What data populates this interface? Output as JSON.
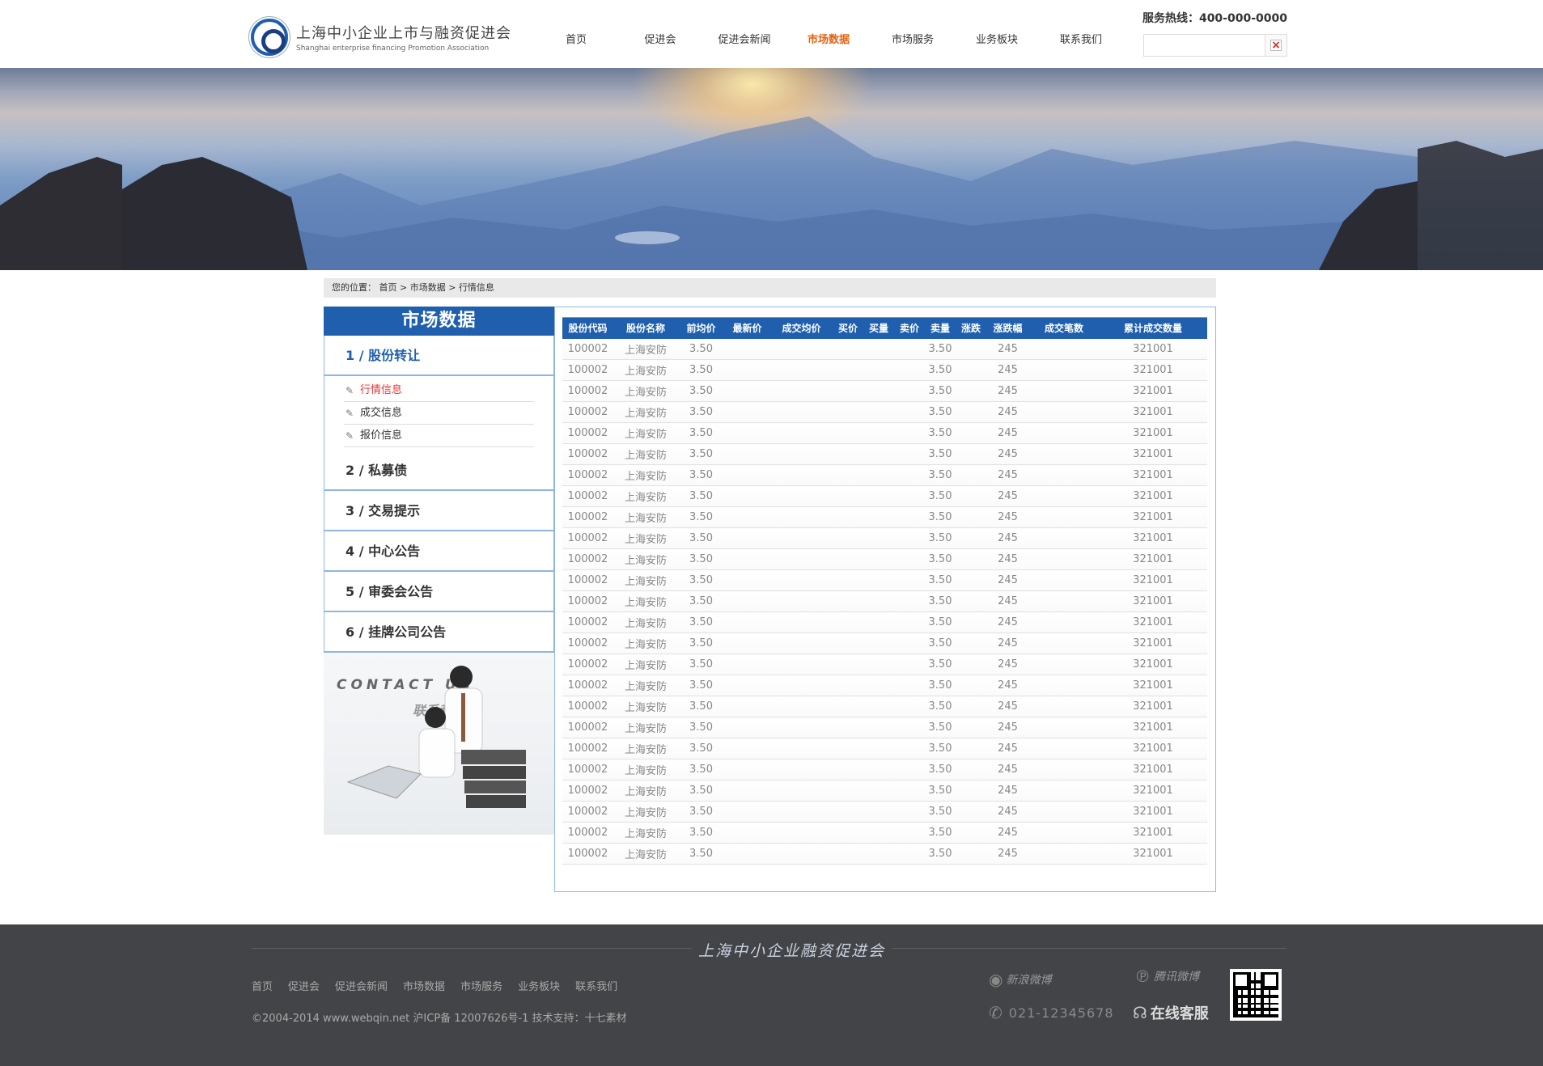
{
  "header": {
    "logo_cn": "上海中小企业上市与融资促进会",
    "logo_en": "Shanghai enterprise financing Promotion Association",
    "hotline": "服务热线：400-000-0000",
    "nav": [
      "首页",
      "促进会",
      "促进会新闻",
      "市场数据",
      "市场服务",
      "业务板块",
      "联系我们"
    ],
    "active_nav": "市场数据",
    "search_placeholder": ""
  },
  "breadcrumb": {
    "prefix": "您的位置：",
    "items": [
      "首页",
      "市场数据",
      "行情信息"
    ],
    "separator": ">"
  },
  "sidebar": {
    "title": "市场数据",
    "sections": [
      {
        "label": "1 / 股份转让",
        "sub": [
          "行情信息",
          "成交信息",
          "报价信息"
        ],
        "active_sub": "行情信息"
      },
      {
        "label": "2 / 私募债"
      },
      {
        "label": "3 / 交易提示"
      },
      {
        "label": "4 / 中心公告"
      },
      {
        "label": "5 / 审委会公告"
      },
      {
        "label": "6 / 挂牌公司公告"
      }
    ],
    "contact_en": "CONTACT US",
    "contact_cn": "联系我们"
  },
  "table": {
    "headers": [
      "股份代码",
      "股份名称",
      "前均价",
      "最新价",
      "成交均价",
      "买价",
      "买量",
      "卖价",
      "卖量",
      "涨跌",
      "涨跌幅",
      "成交笔数",
      "累计成交数量"
    ],
    "rows": [
      [
        "100002",
        "上海安防",
        "3.50",
        "",
        "",
        "",
        "",
        "",
        "3.50",
        "",
        "245",
        "",
        "321001"
      ],
      [
        "100002",
        "上海安防",
        "3.50",
        "",
        "",
        "",
        "",
        "",
        "3.50",
        "",
        "245",
        "",
        "321001"
      ],
      [
        "100002",
        "上海安防",
        "3.50",
        "",
        "",
        "",
        "",
        "",
        "3.50",
        "",
        "245",
        "",
        "321001"
      ],
      [
        "100002",
        "上海安防",
        "3.50",
        "",
        "",
        "",
        "",
        "",
        "3.50",
        "",
        "245",
        "",
        "321001"
      ],
      [
        "100002",
        "上海安防",
        "3.50",
        "",
        "",
        "",
        "",
        "",
        "3.50",
        "",
        "245",
        "",
        "321001"
      ],
      [
        "100002",
        "上海安防",
        "3.50",
        "",
        "",
        "",
        "",
        "",
        "3.50",
        "",
        "245",
        "",
        "321001"
      ],
      [
        "100002",
        "上海安防",
        "3.50",
        "",
        "",
        "",
        "",
        "",
        "3.50",
        "",
        "245",
        "",
        "321001"
      ],
      [
        "100002",
        "上海安防",
        "3.50",
        "",
        "",
        "",
        "",
        "",
        "3.50",
        "",
        "245",
        "",
        "321001"
      ],
      [
        "100002",
        "上海安防",
        "3.50",
        "",
        "",
        "",
        "",
        "",
        "3.50",
        "",
        "245",
        "",
        "321001"
      ],
      [
        "100002",
        "上海安防",
        "3.50",
        "",
        "",
        "",
        "",
        "",
        "3.50",
        "",
        "245",
        "",
        "321001"
      ],
      [
        "100002",
        "上海安防",
        "3.50",
        "",
        "",
        "",
        "",
        "",
        "3.50",
        "",
        "245",
        "",
        "321001"
      ],
      [
        "100002",
        "上海安防",
        "3.50",
        "",
        "",
        "",
        "",
        "",
        "3.50",
        "",
        "245",
        "",
        "321001"
      ],
      [
        "100002",
        "上海安防",
        "3.50",
        "",
        "",
        "",
        "",
        "",
        "3.50",
        "",
        "245",
        "",
        "321001"
      ],
      [
        "100002",
        "上海安防",
        "3.50",
        "",
        "",
        "",
        "",
        "",
        "3.50",
        "",
        "245",
        "",
        "321001"
      ],
      [
        "100002",
        "上海安防",
        "3.50",
        "",
        "",
        "",
        "",
        "",
        "3.50",
        "",
        "245",
        "",
        "321001"
      ],
      [
        "100002",
        "上海安防",
        "3.50",
        "",
        "",
        "",
        "",
        "",
        "3.50",
        "",
        "245",
        "",
        "321001"
      ],
      [
        "100002",
        "上海安防",
        "3.50",
        "",
        "",
        "",
        "",
        "",
        "3.50",
        "",
        "245",
        "",
        "321001"
      ],
      [
        "100002",
        "上海安防",
        "3.50",
        "",
        "",
        "",
        "",
        "",
        "3.50",
        "",
        "245",
        "",
        "321001"
      ],
      [
        "100002",
        "上海安防",
        "3.50",
        "",
        "",
        "",
        "",
        "",
        "3.50",
        "",
        "245",
        "",
        "321001"
      ],
      [
        "100002",
        "上海安防",
        "3.50",
        "",
        "",
        "",
        "",
        "",
        "3.50",
        "",
        "245",
        "",
        "321001"
      ],
      [
        "100002",
        "上海安防",
        "3.50",
        "",
        "",
        "",
        "",
        "",
        "3.50",
        "",
        "245",
        "",
        "321001"
      ],
      [
        "100002",
        "上海安防",
        "3.50",
        "",
        "",
        "",
        "",
        "",
        "3.50",
        "",
        "245",
        "",
        "321001"
      ],
      [
        "100002",
        "上海安防",
        "3.50",
        "",
        "",
        "",
        "",
        "",
        "3.50",
        "",
        "245",
        "",
        "321001"
      ],
      [
        "100002",
        "上海安防",
        "3.50",
        "",
        "",
        "",
        "",
        "",
        "3.50",
        "",
        "245",
        "",
        "321001"
      ],
      [
        "100002",
        "上海安防",
        "3.50",
        "",
        "",
        "",
        "",
        "",
        "3.50",
        "",
        "245",
        "",
        "321001"
      ]
    ]
  },
  "footer": {
    "logo_text": "上海中小企业融资促进会",
    "nav": [
      "首页",
      "促进会",
      "促进会新闻",
      "市场数据",
      "市场服务",
      "业务板块",
      "联系我们"
    ],
    "copyright": "©2004-2014 www.webqin.net 沪ICP备 12007626号-1 技术支持：十七素材",
    "weibo_sina": "新浪微博",
    "weibo_tencent": "腾讯微博",
    "phone": "021-12345678",
    "online_service": "在线客服"
  },
  "colors": {
    "primary": "#1f5fae",
    "accent": "#e8600e",
    "border": "#8fb6e2",
    "footer_bg": "#434447"
  }
}
